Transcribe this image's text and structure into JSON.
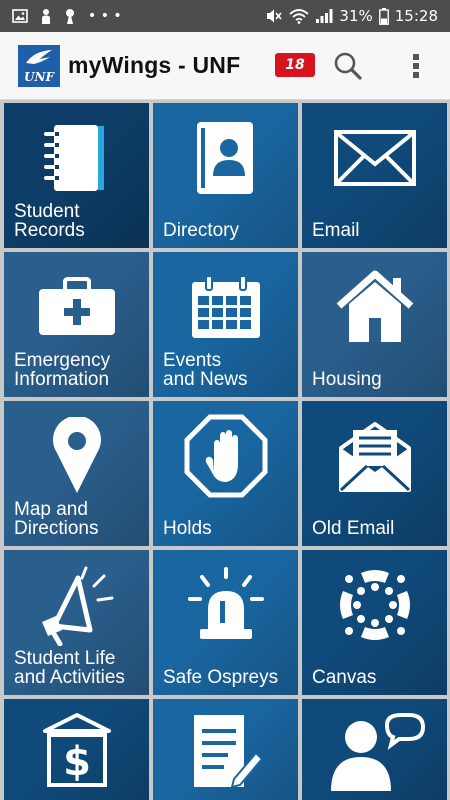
{
  "status_bar": {
    "battery": "31%",
    "time": "15:28"
  },
  "app_bar": {
    "logo_text": "UNF",
    "title": "myWings - UNF",
    "notification_count": "18"
  },
  "tiles": [
    {
      "label": "Student\nRecords",
      "icon": "notebook-icon"
    },
    {
      "label": "Directory",
      "icon": "address-book-icon"
    },
    {
      "label": "Email",
      "icon": "envelope-icon"
    },
    {
      "label": "Emergency\nInformation",
      "icon": "first-aid-kit-icon"
    },
    {
      "label": "Events\nand News",
      "icon": "calendar-icon"
    },
    {
      "label": "Housing",
      "icon": "house-icon"
    },
    {
      "label": "Map and\nDirections",
      "icon": "map-pin-icon"
    },
    {
      "label": "Holds",
      "icon": "stop-hand-icon"
    },
    {
      "label": "Old Email",
      "icon": "open-envelope-icon"
    },
    {
      "label": "Student Life\nand Activities",
      "icon": "megaphone-icon"
    },
    {
      "label": "Safe Ospreys",
      "icon": "siren-icon"
    },
    {
      "label": "Canvas",
      "icon": "canvas-logo-icon"
    },
    {
      "label": "",
      "icon": "bank-dollar-icon"
    },
    {
      "label": "",
      "icon": "document-edit-icon"
    },
    {
      "label": "",
      "icon": "person-chat-icon"
    }
  ]
}
